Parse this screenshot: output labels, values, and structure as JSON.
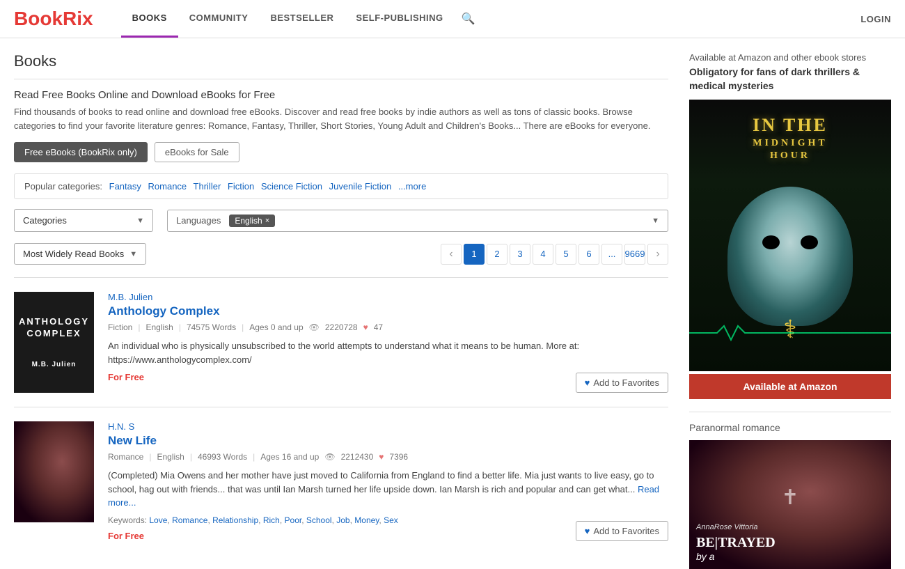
{
  "header": {
    "logo_b": "B",
    "logo_rest": "ookRix",
    "nav": [
      {
        "label": "BOOKS",
        "active": true
      },
      {
        "label": "COMMUNITY",
        "active": false
      },
      {
        "label": "BESTSELLER",
        "active": false
      },
      {
        "label": "SELF-PUBLISHING",
        "active": false
      }
    ],
    "login": "LOGIN"
  },
  "page": {
    "title": "Books",
    "intro_heading": "Read Free Books Online and Download eBooks for Free",
    "intro_text": "Find thousands of books to read online and download free eBooks. Discover and read free books by indie authors as well as tons of classic books. Browse categories to find your favorite literature genres: Romance, Fantasy, Thriller, Short Stories, Young Adult and Children's Books... There are eBooks for everyone.",
    "filter_btn_active": "Free eBooks (BookRix only)",
    "filter_btn_inactive": "eBooks for Sale"
  },
  "categories": {
    "label": "Popular categories:",
    "items": [
      "Fantasy",
      "Romance",
      "Thriller",
      "Fiction",
      "Science Fiction",
      "Juvenile Fiction",
      "...more"
    ]
  },
  "dropdowns": {
    "categories_placeholder": "Categories",
    "languages_label": "Languages",
    "selected_language": "English",
    "lang_close": "×"
  },
  "sort": {
    "label": "Most Widely Read Books",
    "arrow": "▼"
  },
  "pagination": {
    "prev": "‹",
    "next": "›",
    "pages": [
      "1",
      "2",
      "3",
      "4",
      "5",
      "6",
      "...",
      "9669"
    ],
    "active": "1"
  },
  "books": [
    {
      "author": "M.B. Julien",
      "title": "Anthology Complex",
      "cover_line1": "ANTHOLOGY",
      "cover_line2": "COMPLEX",
      "cover_author": "M.B. Julien",
      "genre": "Fiction",
      "language": "English",
      "words": "74575 Words",
      "ages": "Ages 0 and up",
      "views": "2220728",
      "hearts": "47",
      "description": "An individual who is physically unsubscribed to the world attempts to understand what it means to be human.  More at: https://www.anthologycomplex.com/",
      "price": "For Free",
      "add_favorites": "Add to Favorites"
    },
    {
      "author": "H.N. S",
      "title": "New Life",
      "genre": "Romance",
      "language": "English",
      "words": "46993 Words",
      "ages": "Ages 16 and up",
      "views": "2212430",
      "hearts": "7396",
      "description": "(Completed) Mia Owens and her mother have just moved to California from England to find a better life. Mia just wants to live easy, go to school, hag out with friends... that was until Ian Marsh turned her life upside down. Ian Marsh is rich and popular and can get what...",
      "read_more": "Read more...",
      "keywords_label": "Keywords:",
      "keywords": [
        "Love",
        "Romance",
        "Relationship",
        "Rich",
        "Poor",
        "School",
        "Job",
        "Money",
        "Sex"
      ],
      "price": "For Free",
      "add_favorites": "Add to Favorites"
    }
  ],
  "sidebar": {
    "ad_text": "Available at Amazon and other ebook stores",
    "ad_bold": "Obligatory for fans of dark thrillers & medical mysteries",
    "book1": {
      "title_line1": "IN THE",
      "title_line2": "MIDNIGHT",
      "title_line3": "HOUR",
      "amazon_btn": "Available at Amazon"
    },
    "section2_title": "Paranormal romance",
    "book2": {
      "author": "AnnaRose Vittoria",
      "title_line1": "BE|TRAYED",
      "title_line2": "by a"
    }
  }
}
